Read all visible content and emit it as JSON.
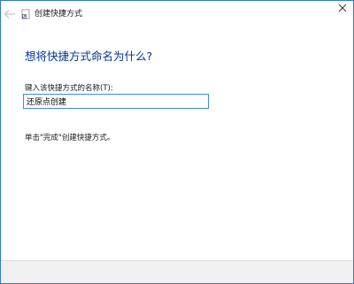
{
  "window": {
    "title": "创建快捷方式"
  },
  "main": {
    "heading": "想将快捷方式命名为什么?",
    "field_label": "键入该快捷方式的名称(T):",
    "name_value": "还原点创建",
    "hint": "单击\"完成\"创建快捷方式。"
  },
  "icons": {
    "back": "back-arrow-icon",
    "app": "shortcut-icon",
    "close": "close-icon"
  },
  "colors": {
    "border_accent": "#2b7bd6",
    "heading": "#003399",
    "input_focus": "#3c8de0",
    "footer": "#f0f0f0"
  }
}
